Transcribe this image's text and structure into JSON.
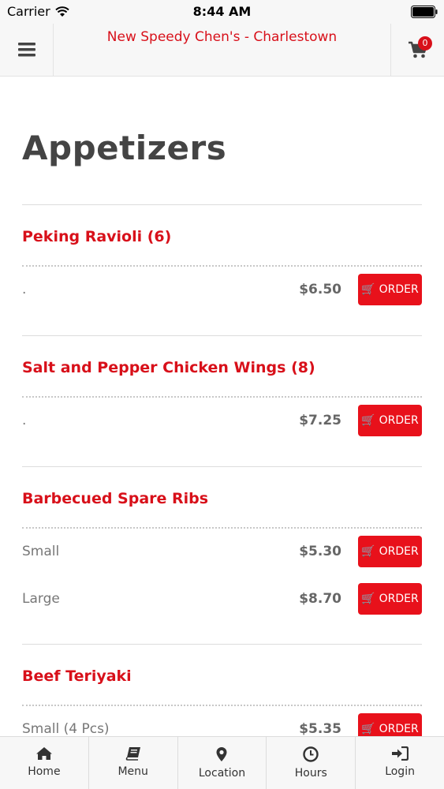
{
  "status_bar": {
    "carrier": "Carrier",
    "time": "8:44 AM"
  },
  "header": {
    "title": "New Speedy Chen's - Charlestown",
    "cart_count": "0"
  },
  "section": {
    "title": "Appetizers"
  },
  "order_label": "ORDER",
  "items": [
    {
      "name": "Peking Ravioli (6)",
      "options": [
        {
          "label": ".",
          "price": "$6.50"
        }
      ]
    },
    {
      "name": "Salt and Pepper Chicken Wings (8)",
      "options": [
        {
          "label": ".",
          "price": "$7.25"
        }
      ]
    },
    {
      "name": "Barbecued Spare Ribs",
      "options": [
        {
          "label": "Small",
          "price": "$5.30"
        },
        {
          "label": "Large",
          "price": "$8.70"
        }
      ]
    },
    {
      "name": "Beef Teriyaki",
      "options": [
        {
          "label": "Small (4 Pcs)",
          "price": "$5.35"
        }
      ]
    }
  ],
  "nav": [
    {
      "label": "Home",
      "icon": "home-icon"
    },
    {
      "label": "Menu",
      "icon": "book-icon"
    },
    {
      "label": "Location",
      "icon": "map-pin-icon"
    },
    {
      "label": "Hours",
      "icon": "clock-icon"
    },
    {
      "label": "Login",
      "icon": "sign-in-icon"
    }
  ],
  "colors": {
    "brand_red": "#d8101a",
    "button_red": "#e8111b"
  }
}
